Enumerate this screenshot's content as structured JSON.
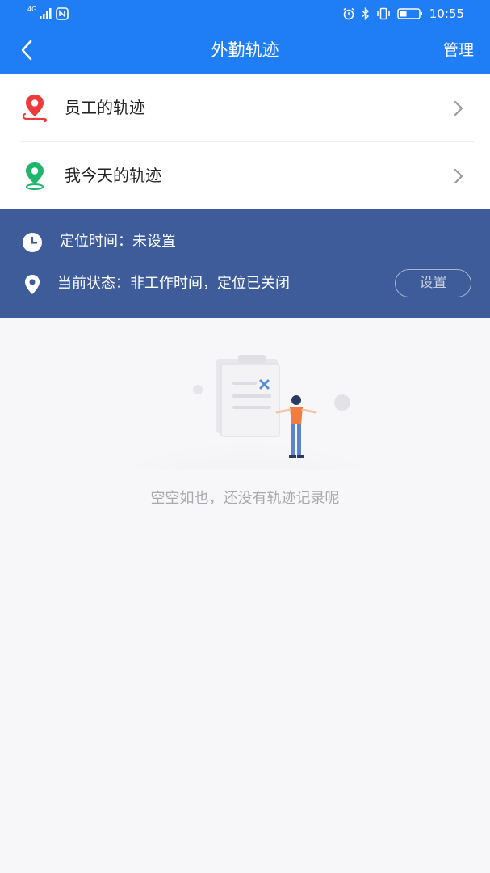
{
  "statusbar": {
    "network": "4G",
    "time": "10:55"
  },
  "navbar": {
    "back_icon": "chevron-left-icon",
    "title": "外勤轨迹",
    "manage_label": "管理"
  },
  "menu": {
    "items": [
      {
        "label": "员工的轨迹",
        "icon": "route-pin-icon",
        "icon_color": "#ee3a3a"
      },
      {
        "label": "我今天的轨迹",
        "icon": "location-pin-icon",
        "icon_color": "#1fb56a"
      }
    ]
  },
  "info": {
    "time_text": "定位时间：未设置",
    "status_text": "当前状态：非工作时间，定位已关闭",
    "set_button": "设置",
    "panel_color": "#3d5c99"
  },
  "empty": {
    "message": "空空如也，还没有轨迹记录呢"
  },
  "colors": {
    "primary": "#1f7ef5",
    "background": "#f7f7f9"
  }
}
